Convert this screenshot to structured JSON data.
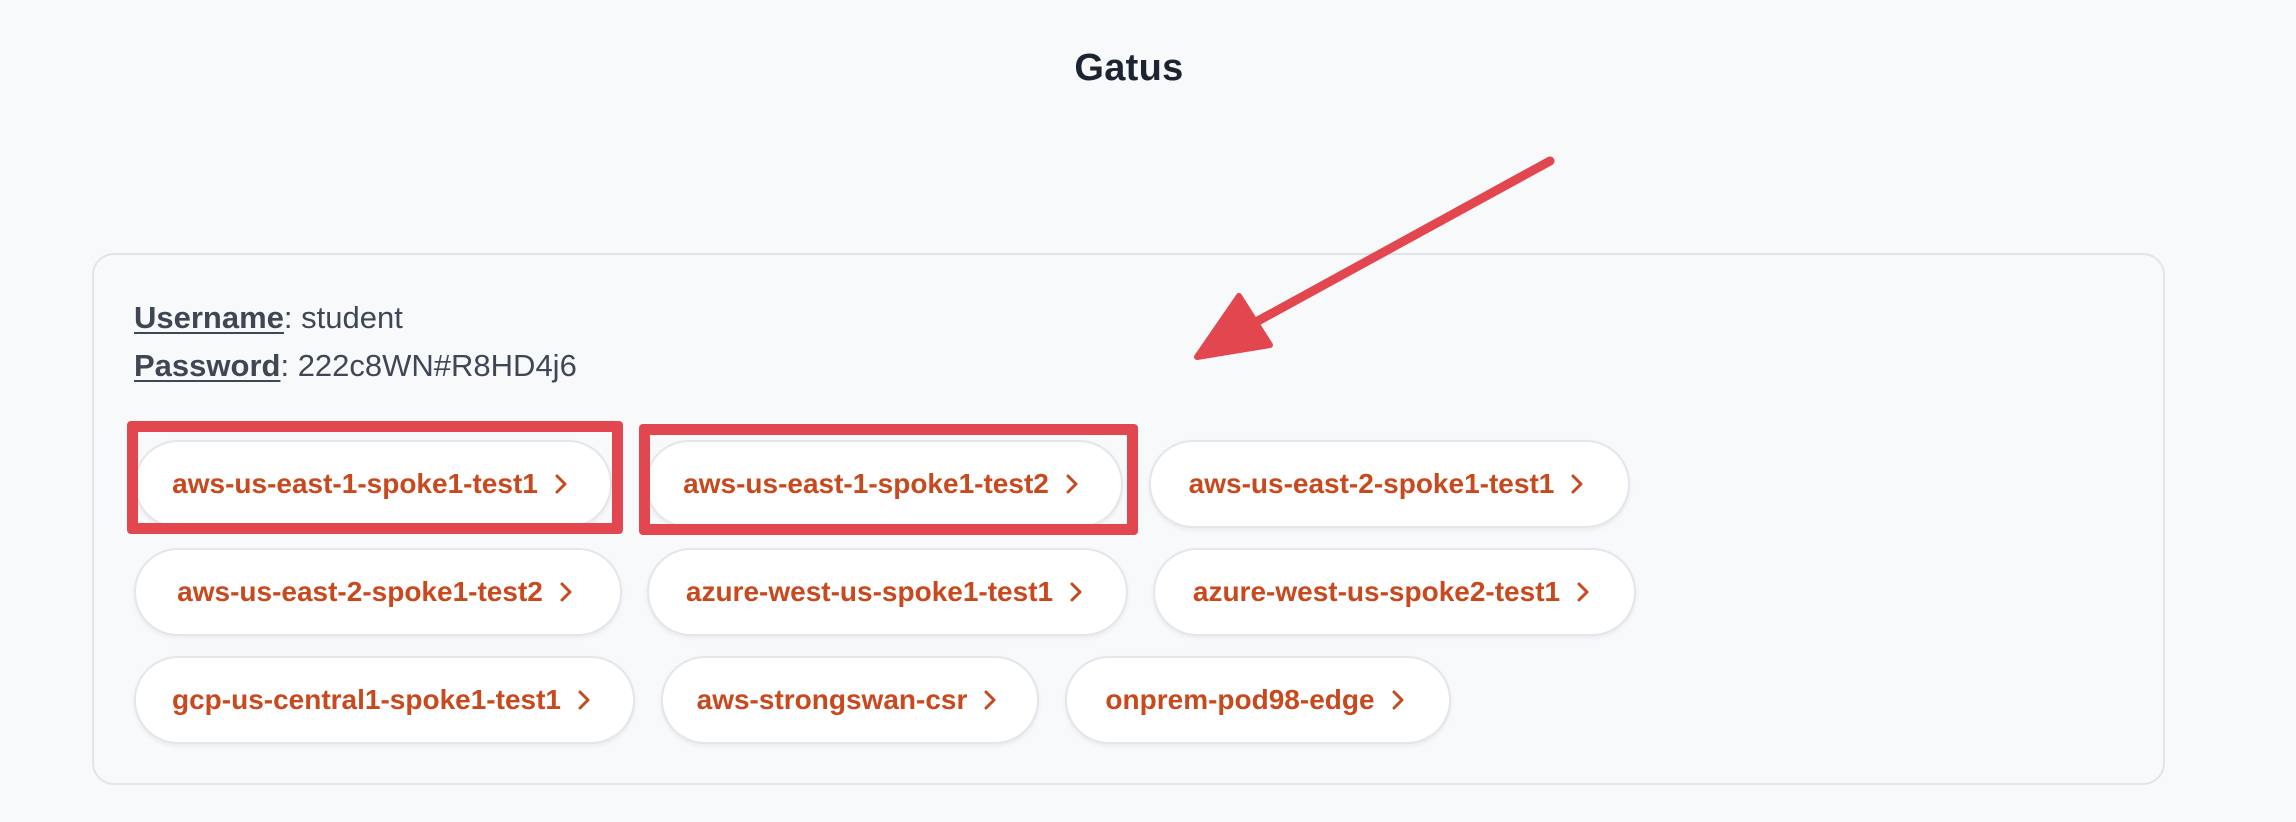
{
  "header": {
    "title": "Gatus"
  },
  "credentials": {
    "username_label": "Username",
    "username_value": "student",
    "password_label": "Password",
    "password_value": "222c8WN#R8HD4j6"
  },
  "endpoints": [
    {
      "label": "aws-us-east-1-spoke1-test1"
    },
    {
      "label": "aws-us-east-1-spoke1-test2"
    },
    {
      "label": "aws-us-east-2-spoke1-test1"
    },
    {
      "label": "aws-us-east-2-spoke1-test2"
    },
    {
      "label": "azure-west-us-spoke1-test1"
    },
    {
      "label": "azure-west-us-spoke2-test1"
    },
    {
      "label": "gcp-us-central1-spoke1-test1"
    },
    {
      "label": "aws-strongswan-csr"
    },
    {
      "label": "onprem-pod98-edge"
    }
  ],
  "colors": {
    "accent": "#c8491d",
    "annotation": "#e2464e",
    "background": "#f8f9fb"
  },
  "icons": {
    "pill_chevron": "chevron-right-icon",
    "annotation_arrow": "arrow-icon"
  }
}
